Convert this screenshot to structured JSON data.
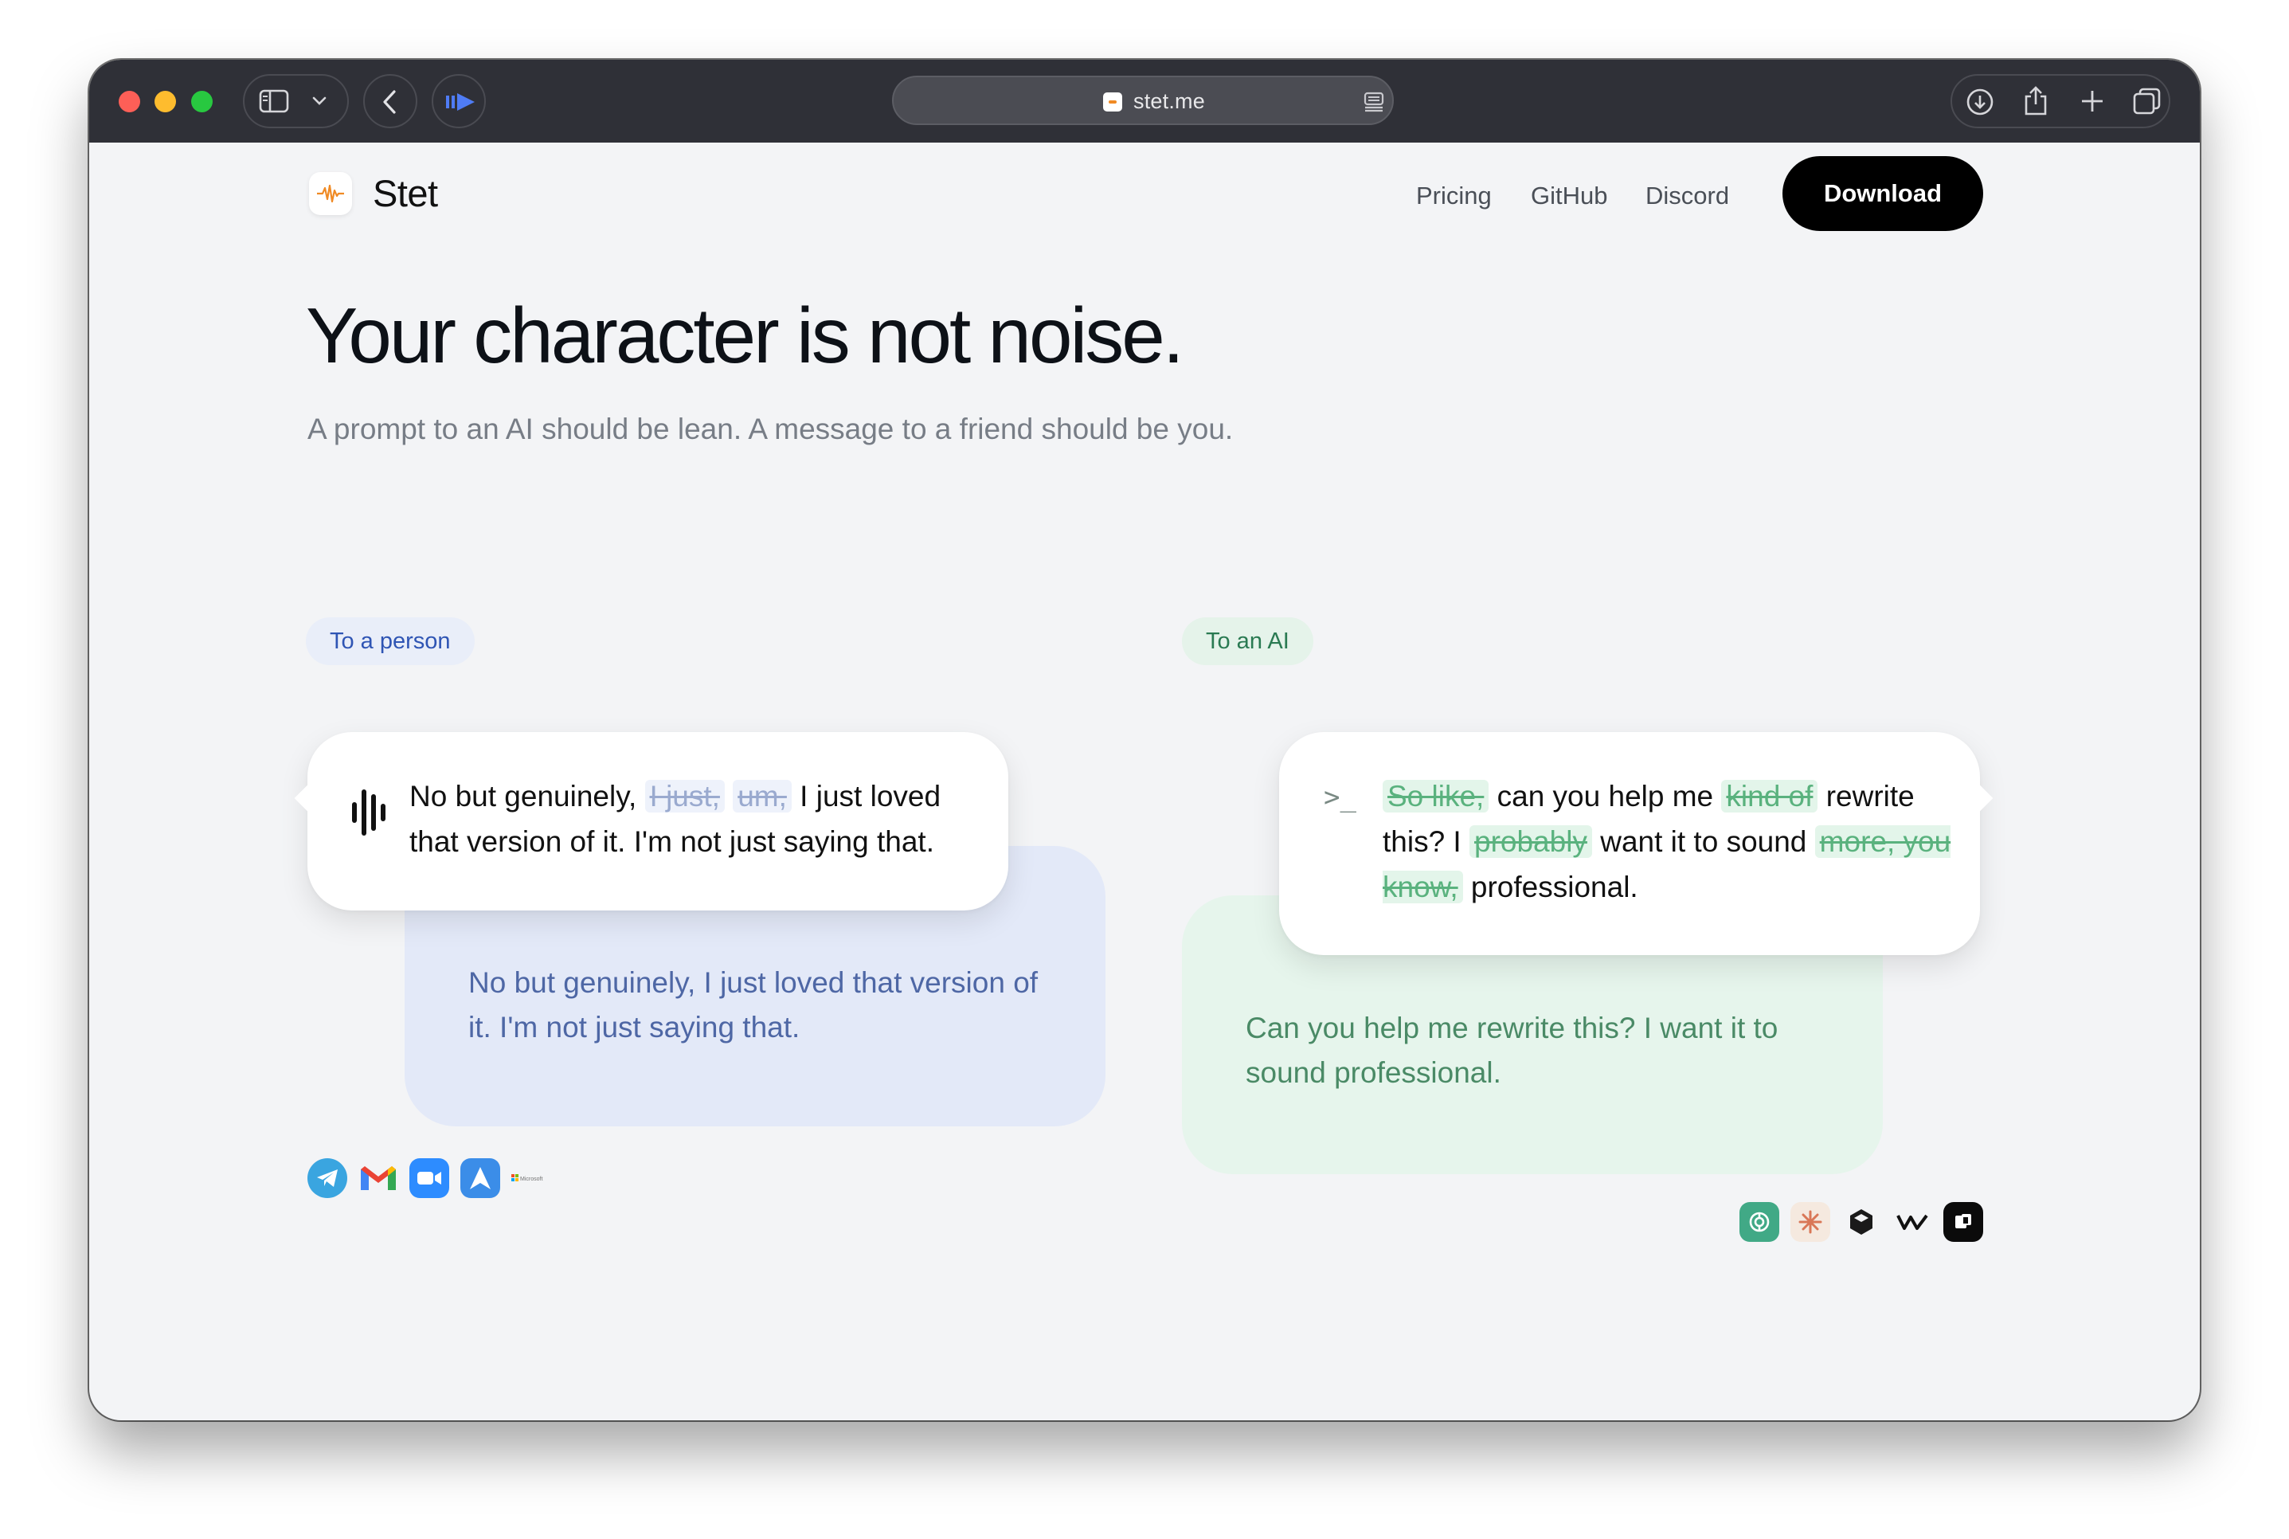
{
  "browser": {
    "url": "stet.me",
    "reader_icon": "reader-mode-icon",
    "icons": [
      "sidebar-icon",
      "chevron-down-icon",
      "back-arrow-icon",
      "extension-icon",
      "download-icon",
      "share-icon",
      "plus-icon",
      "tabs-icon"
    ]
  },
  "nav": {
    "brand": "Stet",
    "links": [
      "Pricing",
      "GitHub",
      "Discord"
    ],
    "download_label": "Download"
  },
  "hero": {
    "title": "Your character is not noise.",
    "subtitle": "A prompt to an AI should be lean. A message to a friend should be you."
  },
  "person": {
    "tag": "To a person",
    "raw": {
      "t1": "No but genuinely, ",
      "s1": "I just,",
      "s2": "um,",
      "t2": " I just loved that version of it. I'm not just saying that."
    },
    "clean": "No but genuinely, I just loved that version of it. I'm not just saying that.",
    "apps": [
      "telegram-icon",
      "gmail-icon",
      "zoom-icon",
      "spark-icon",
      "microsoft-icon"
    ],
    "microsoft_label": "Microsoft"
  },
  "ai": {
    "tag": "To an AI",
    "prompt_symbol": ">_",
    "raw": {
      "s1": "So like,",
      "t1": " can you help me ",
      "s2": "kind of",
      "t2": " rewrite this? I ",
      "s3": "probably",
      "t3": " want it to sound ",
      "s4": "more, you know,",
      "t4": " professional."
    },
    "clean": "Can you help me rewrite this? I want it to sound professional.",
    "apps": [
      "chatgpt-icon",
      "claude-icon",
      "cube-icon",
      "windsurf-icon",
      "cursor-icon"
    ]
  },
  "colors": {
    "accent_blue": "#2f55b4",
    "accent_green": "#2a7a52",
    "button_bg": "#000000",
    "page_bg": "#f3f4f6"
  }
}
